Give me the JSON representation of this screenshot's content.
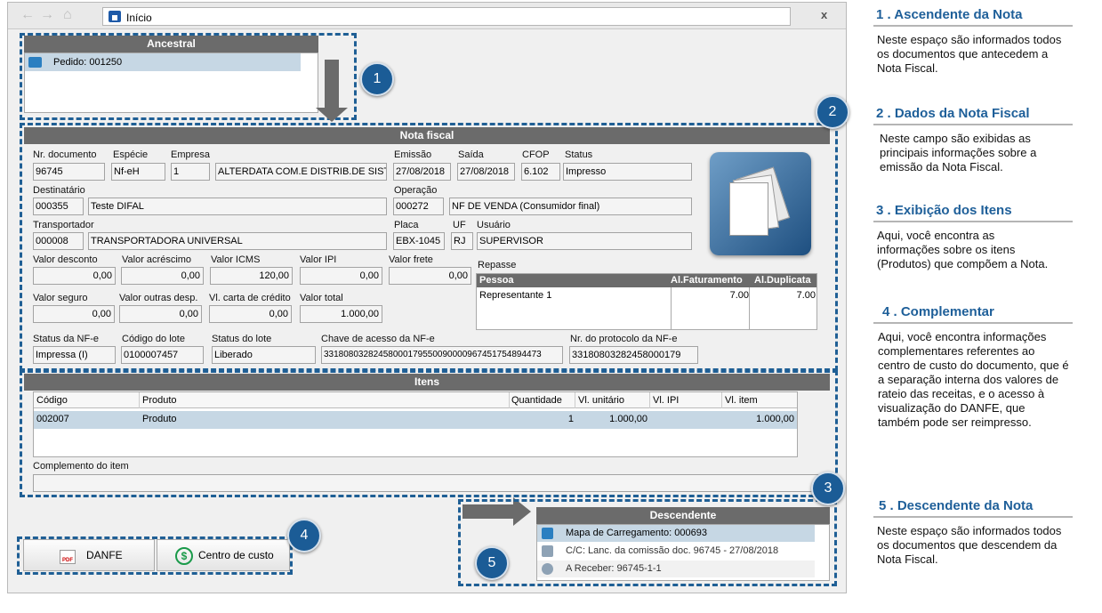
{
  "browser": {
    "address": "Início",
    "close": "x"
  },
  "ancestral": {
    "title": "Ancestral",
    "items": [
      {
        "icon": "list-icon",
        "label": "Pedido: 001250"
      }
    ]
  },
  "nota_fiscal": {
    "title": "Nota fiscal",
    "labels": {
      "nr_documento": "Nr. documento",
      "especie": "Espécie",
      "empresa": "Empresa",
      "emissao": "Emissão",
      "saida": "Saída",
      "cfop": "CFOP",
      "status": "Status",
      "destinatario": "Destinatário",
      "operacao": "Operação",
      "transportador": "Transportador",
      "placa": "Placa",
      "uf": "UF",
      "usuario": "Usuário",
      "valor_desconto": "Valor desconto",
      "valor_acrescimo": "Valor acréscimo",
      "valor_icms": "Valor ICMS",
      "valor_ipi": "Valor IPI",
      "valor_frete": "Valor frete",
      "valor_seguro": "Valor seguro",
      "valor_outras": "Valor outras desp.",
      "vl_carta": "Vl. carta de crédito",
      "valor_total": "Valor total",
      "status_nfe": "Status da NF-e",
      "codigo_lote": "Código do lote",
      "status_lote": "Status do lote",
      "chave": "Chave de acesso da NF-e",
      "protocolo": "Nr. do protocolo da NF-e",
      "repasse": "Repasse"
    },
    "values": {
      "nr_documento": "96745",
      "especie": "Nf-eH",
      "empresa_cod": "1",
      "empresa_nome": "ALTERDATA COM.E DISTRIB.DE SIST",
      "emissao": "27/08/2018",
      "saida": "27/08/2018",
      "cfop": "6.102",
      "status": "Impresso",
      "destinatario_cod": "000355",
      "destinatario_nome": "Teste DIFAL",
      "operacao_cod": "000272",
      "operacao_nome": "NF DE VENDA (Consumidor final)",
      "transportador_cod": "000008",
      "transportador_nome": "TRANSPORTADORA UNIVERSAL",
      "placa": "EBX-1045",
      "uf": "RJ",
      "usuario": "SUPERVISOR",
      "valor_desconto": "0,00",
      "valor_acrescimo": "0,00",
      "valor_icms": "120,00",
      "valor_ipi": "0,00",
      "valor_frete": "0,00",
      "valor_seguro": "0,00",
      "valor_outras": "0,00",
      "vl_carta": "0,00",
      "valor_total": "1.000,00",
      "status_nfe": "Impressa (I)",
      "codigo_lote": "0100007457",
      "status_lote": "Liberado",
      "chave": "33180803282458000179550090000967451754894473",
      "protocolo": "3318080328245800017​9"
    },
    "repasse": {
      "headers": [
        "Pessoa",
        "Al.Faturamento",
        "Al.Duplicata"
      ],
      "rows": [
        [
          "Representante 1",
          "7.00",
          "7.00"
        ]
      ]
    }
  },
  "itens": {
    "title": "Itens",
    "headers": [
      "Código",
      "Produto",
      "Quantidade",
      "Vl. unitário",
      "Vl. IPI",
      "Vl. item"
    ],
    "rows": [
      [
        "002007",
        "Produto",
        "1",
        "1.000,00",
        "",
        "1.000,00"
      ]
    ],
    "complemento_label": "Complemento do item"
  },
  "buttons": {
    "danfe": "DANFE",
    "centro": "Centro de custo"
  },
  "descendente": {
    "title": "Descendente",
    "items": [
      {
        "icon": "map-icon",
        "label": "Mapa de Carregamento: 000693"
      },
      {
        "icon": "gear-icon",
        "label": "C/C: Lanc. da comissão doc. 96745 - 27/08/2018"
      },
      {
        "icon": "money-icon",
        "label": "A Receber: 96745-1-1"
      }
    ]
  },
  "badges": [
    "1",
    "2",
    "3",
    "4",
    "5"
  ],
  "help": [
    {
      "title": "1 . Ascendente da Nota",
      "text": "Neste espaço são informados todos os documentos que antecedem a Nota Fiscal."
    },
    {
      "title": "2 . Dados da Nota Fiscal",
      "text": "Neste campo são exibidas as principais informações sobre a emissão da Nota Fiscal."
    },
    {
      "title": "3 . Exibição dos Itens",
      "text": "Aqui, você encontra as informações sobre os itens (Produtos) que compõem a Nota."
    },
    {
      "title": "4 . Complementar",
      "text": "Aqui, você encontra informações complementares referentes ao centro de custo do documento, que é a separação interna dos valores de rateio das receitas, e o acesso à visualização do DANFE, que também pode ser reimpresso."
    },
    {
      "title": "5 . Descendente da Nota",
      "text": "Neste espaço são informados todos os documentos que descendem da Nota Fiscal."
    }
  ]
}
